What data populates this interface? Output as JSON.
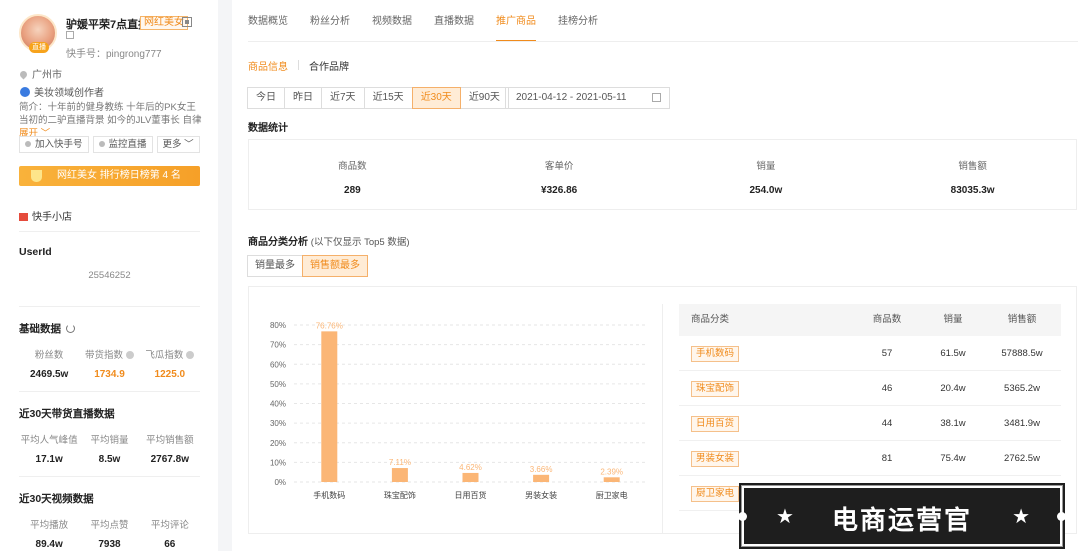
{
  "profile": {
    "name": "驴媛平荣7点直播",
    "badge": "网红美女",
    "avatar_tag": "直播",
    "kuaishou_id": "快手号：pingrong777",
    "city": "广州市",
    "creator_type": "美妆领域创作者",
    "intro": "简介：十年前的健身教练 十年后的PK女王 当初的二驴直播背景 如今的JLV董事长 自律",
    "intro_more": "展开",
    "btn_add": "加入快手号",
    "btn_monitor": "监控直播",
    "btn_more": "更多",
    "rank": "网红美女 排行榜日榜第 4 名",
    "shop": "快手小店"
  },
  "userid": {
    "label": "UserId",
    "value": "25546252"
  },
  "basic": {
    "title": "基础数据",
    "items": [
      {
        "label": "粉丝数",
        "value": "2469.5w"
      },
      {
        "label": "带货指数",
        "value": "1734.9"
      },
      {
        "label": "飞瓜指数",
        "value": "1225.0"
      }
    ]
  },
  "live30": {
    "title": "近30天带货直播数据",
    "items": [
      {
        "label": "平均人气峰值",
        "value": "17.1w"
      },
      {
        "label": "平均销量",
        "value": "8.5w"
      },
      {
        "label": "平均销售额",
        "value": "2767.8w"
      }
    ]
  },
  "video30": {
    "title": "近30天视频数据",
    "items": [
      {
        "label": "平均播放",
        "value": "89.4w"
      },
      {
        "label": "平均点赞",
        "value": "7938"
      },
      {
        "label": "平均评论",
        "value": "66"
      }
    ]
  },
  "tabs": [
    "数据概览",
    "粉丝分析",
    "视频数据",
    "直播数据",
    "推广商品",
    "挂榜分析"
  ],
  "subtabs": [
    "商品信息",
    "合作品牌"
  ],
  "ranges": [
    "今日",
    "昨日",
    "近7天",
    "近15天",
    "近30天",
    "近90天"
  ],
  "date_range": "2021-04-12  -  2021-05-11",
  "stats": {
    "title": "数据统计",
    "items": [
      {
        "label": "商品数",
        "value": "289"
      },
      {
        "label": "客单价",
        "value": "¥326.86"
      },
      {
        "label": "销量",
        "value": "254.0w"
      },
      {
        "label": "销售额",
        "value": "83035.3w"
      }
    ]
  },
  "category": {
    "title": "商品分类分析",
    "note": "(以下仅显示 Top5 数据)",
    "toggles": [
      "销量最多",
      "销售额最多"
    ]
  },
  "table": {
    "headers": [
      "商品分类",
      "商品数",
      "销量",
      "销售额"
    ],
    "rows": [
      [
        "手机数码",
        "57",
        "61.5w",
        "57888.5w"
      ],
      [
        "珠宝配饰",
        "46",
        "20.4w",
        "5365.2w"
      ],
      [
        "日用百货",
        "44",
        "38.1w",
        "3481.9w"
      ],
      [
        "男装女装",
        "81",
        "75.4w",
        "2762.5w"
      ],
      [
        "厨卫家电",
        "",
        "",
        ""
      ]
    ]
  },
  "watermark": {
    "text": "电商运营官",
    "star": "★"
  },
  "colors": {
    "accent": "#f08b1c",
    "bar": "#fbb676"
  },
  "chart_data": {
    "type": "bar",
    "categories": [
      "手机数码",
      "珠宝配饰",
      "日用百货",
      "男装女装",
      "厨卫家电"
    ],
    "values": [
      76.76,
      7.11,
      4.62,
      3.66,
      2.39
    ],
    "value_labels": [
      "76.76%",
      "7.11%",
      "4.62%",
      "3.66%",
      "2.39%"
    ],
    "yticks": [
      "0%",
      "10%",
      "20%",
      "30%",
      "40%",
      "50%",
      "60%",
      "70%",
      "80%"
    ],
    "ylim": [
      0,
      80
    ],
    "grid": true
  }
}
